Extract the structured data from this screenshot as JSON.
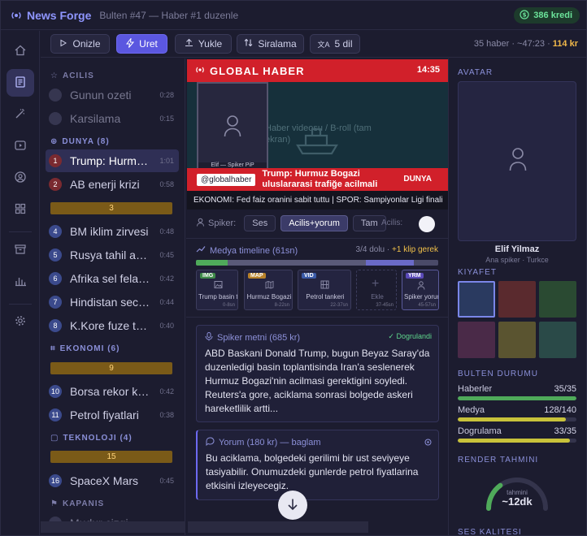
{
  "header": {
    "app_title": "News Forge",
    "subtitle": "Bulten #47 — Haber #1 duzenle",
    "credit": "386 kredi"
  },
  "toolbar": {
    "preview_label": "Onizle",
    "generate_label": "Uret",
    "upload_label": "Yukle",
    "sort_label": "Siralama",
    "languages_label": "5 dil",
    "stats_prefix": "35 haber · ~47:23 · ",
    "stats_cost": "114 kr"
  },
  "rundown": {
    "sections": [
      {
        "label": "ACILIS"
      },
      {
        "label": "DUNYA (8)"
      },
      {
        "label": "EKONOMI (6)"
      },
      {
        "label": "TEKNOLOJI (4)"
      },
      {
        "label": "KAPANIS"
      }
    ],
    "items": [
      {
        "num": "",
        "title": "Gunun ozeti",
        "dur": "0:28"
      },
      {
        "num": "",
        "title": "Karsilama",
        "dur": "0:15"
      },
      {
        "num": "1",
        "title": "Trump: Hurmuz Bogazi",
        "dur": "1:01"
      },
      {
        "num": "2",
        "title": "AB enerji krizi",
        "dur": "0:58"
      },
      {
        "num": "4",
        "title": "BM iklim zirvesi",
        "dur": "0:48"
      },
      {
        "num": "5",
        "title": "Rusya tahil anlasmasi",
        "dur": "0:45"
      },
      {
        "num": "6",
        "title": "Afrika sel felaketi",
        "dur": "0:42"
      },
      {
        "num": "7",
        "title": "Hindistan secimleri",
        "dur": "0:44"
      },
      {
        "num": "8",
        "title": "K.Kore fuze testi",
        "dur": "0:40"
      },
      {
        "num": "10",
        "title": "Borsa rekor kirdi",
        "dur": "0:42"
      },
      {
        "num": "11",
        "title": "Petrol fiyatlari",
        "dur": "0:38"
      },
      {
        "num": "16",
        "title": "SpaceX Mars",
        "dur": "0:45"
      },
      {
        "num": "",
        "title": "Mudur cizgi",
        "dur": ""
      }
    ],
    "breaks": [
      "3",
      "9",
      "15"
    ]
  },
  "preview": {
    "brand": "GLOBAL HABER",
    "time": "14:35",
    "pip_label": "Elif — Spiker PiP",
    "broll_text": "Haber videosu / B-roll (tam ekran)",
    "handle": "@globalhaber",
    "headline": "Trump: Hurmuz Bogazi uluslararasi trafiğe acilmali",
    "category": "DUNYA",
    "ticker": "EKONOMI: Fed faiz oranini sabit tuttu  |  SPOR: Sampiyonlar Ligi finali"
  },
  "speaker": {
    "label": "Spiker:",
    "options": [
      "Ses",
      "Acilis+yorum",
      "Tam"
    ],
    "selected": "Acilis+yorum",
    "acilis_label": "Acilis:"
  },
  "timeline": {
    "title": "Medya timeline (61sn)",
    "status": "3/4 dolu · ",
    "need": "+1 klip gerek",
    "segments": [
      {
        "start": 0,
        "end": 13,
        "color": "#4faa5a"
      },
      {
        "start": 13,
        "end": 70,
        "color": "#5a5a78"
      },
      {
        "start": 70,
        "end": 90,
        "color": "#6a6ac8"
      },
      {
        "start": 90,
        "end": 100,
        "color": "#4a4a68"
      }
    ],
    "clips": [
      {
        "tag": "IMG",
        "tag_color": "#3f8a4a",
        "icon": "image-icon",
        "name": "Trump basin t.",
        "len": "0-8sn"
      },
      {
        "tag": "MAP",
        "tag_color": "#b8822a",
        "icon": "map-icon",
        "name": "Hurmuz Bogazi",
        "len": "8-22sn"
      },
      {
        "tag": "VID",
        "tag_color": "#3a5aa8",
        "icon": "film-icon",
        "name": "Petrol tankeri",
        "len": "22-37sn"
      },
      {
        "tag": "",
        "tag_color": "",
        "icon": "plus-icon",
        "name": "Ekle",
        "len": "37-45sn"
      },
      {
        "tag": "YRM",
        "tag_color": "#5a4ab8",
        "icon": "person-icon",
        "name": "Spiker yorum",
        "len": "45-57sn"
      }
    ]
  },
  "script": {
    "title": "Spiker metni (685 kr)",
    "verified": "Dogrulandi",
    "text": "ABD Baskani Donald Trump, bugun Beyaz Saray'da duzenledigi basin toplantisinda Iran'a seslenerek Hurmuz Bogazi'nin acilmasi gerektigini soyledi. Reuters'a gore, aciklama sonrasi bolgede askeri hareketlilik artti..."
  },
  "comment": {
    "title": "Yorum (180 kr) — baglam",
    "text": "Bu aciklama, bolgedeki gerilimi bir ust seviyeye tasiyabilir. Onumuzdeki gunlerde petrol fiyatlarina etkisini izleyecegiz."
  },
  "right": {
    "avatar_h": "AVATAR",
    "avatar_name": "Elif Yilmaz",
    "avatar_sub": "Ana spiker · Turkce",
    "outfit_h": "KIYAFET",
    "outfits": [
      "#2a3a60",
      "#5a2a2e",
      "#2a4a32",
      "#4a2a48",
      "#5a5430",
      "#2a4a48"
    ],
    "status_h": "BULTEN DURUMU",
    "status": [
      {
        "name": "Haberler",
        "value": "35/35",
        "ratio": 1.0,
        "color": "#4faa5a"
      },
      {
        "name": "Medya",
        "value": "128/140",
        "ratio": 0.914,
        "color": "#c8c23a"
      },
      {
        "name": "Dogrulama",
        "value": "33/35",
        "ratio": 0.943,
        "color": "#c8c23a"
      }
    ],
    "render_h": "RENDER TAHMINI",
    "gauge_label": "tahmini",
    "gauge_value": "~12dk",
    "gauge_ratio": 0.3,
    "quality_h": "SES KALITESI"
  },
  "colors": {
    "accent": "#5b57e0",
    "brand_red": "#d1202a",
    "success": "#5ed68c",
    "warning": "#f0b84a"
  }
}
